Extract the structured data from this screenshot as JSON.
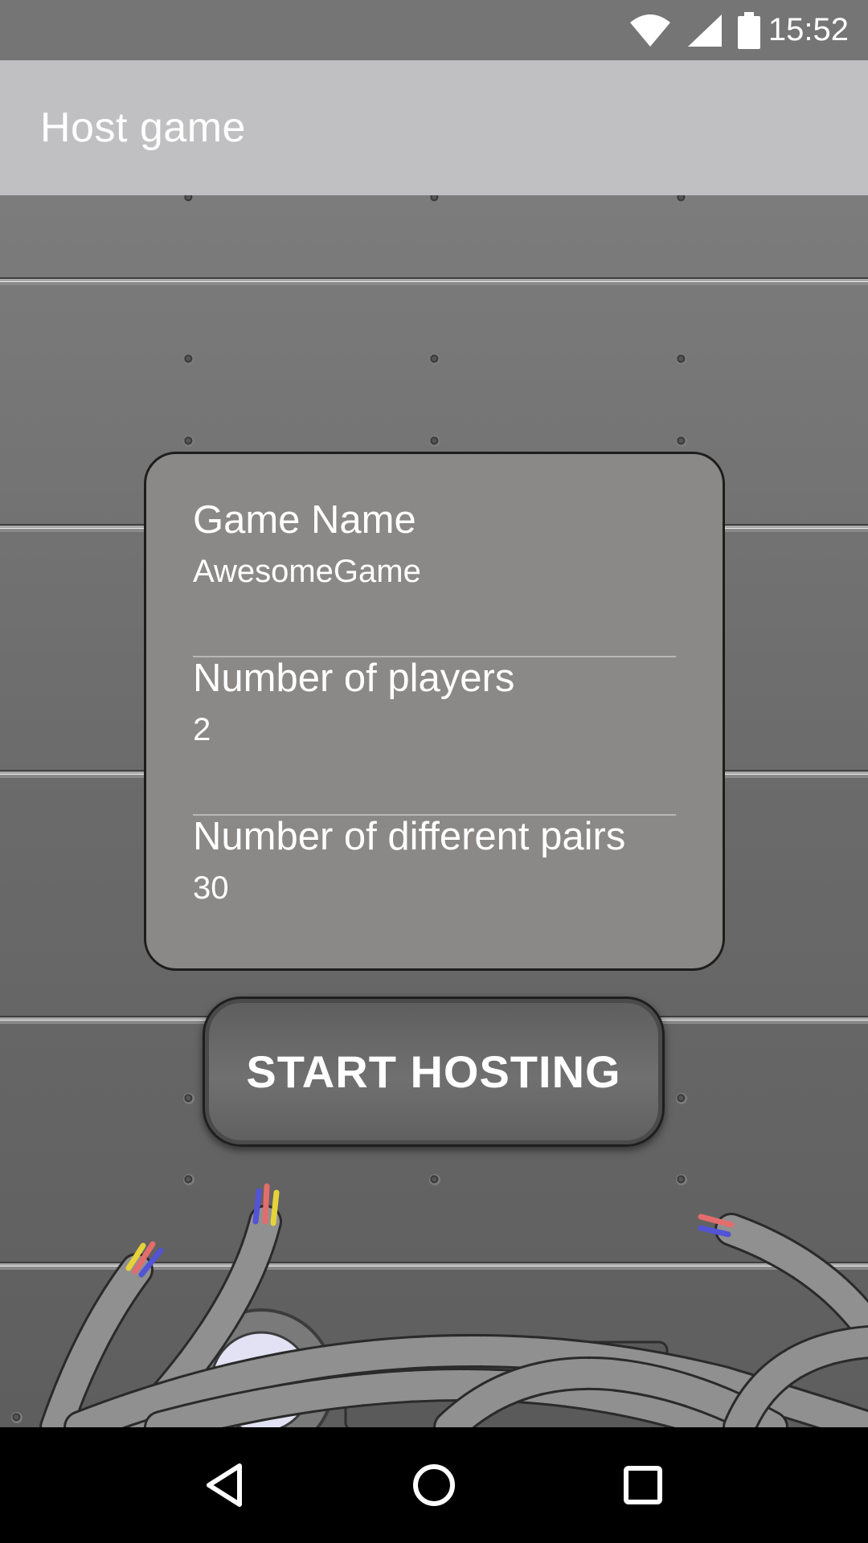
{
  "status_bar": {
    "time": "15:52",
    "icons": [
      "wifi-icon",
      "signal-icon",
      "battery-icon"
    ]
  },
  "app_bar": {
    "title": "Host game"
  },
  "form": {
    "fields": [
      {
        "label": "Game Name",
        "value": "AwesomeGame"
      },
      {
        "label": "Number of players",
        "value": "2"
      },
      {
        "label": "Number of different pairs",
        "value": "30"
      }
    ]
  },
  "start_button": {
    "label": "START HOSTING"
  },
  "nav_bar": {
    "icons": [
      "back-icon",
      "home-icon",
      "recents-icon"
    ]
  },
  "colors": {
    "status_bar": "#757575",
    "app_bar": "#c0c0c2",
    "card": "#8a8987",
    "cable_segment": "#909090"
  }
}
